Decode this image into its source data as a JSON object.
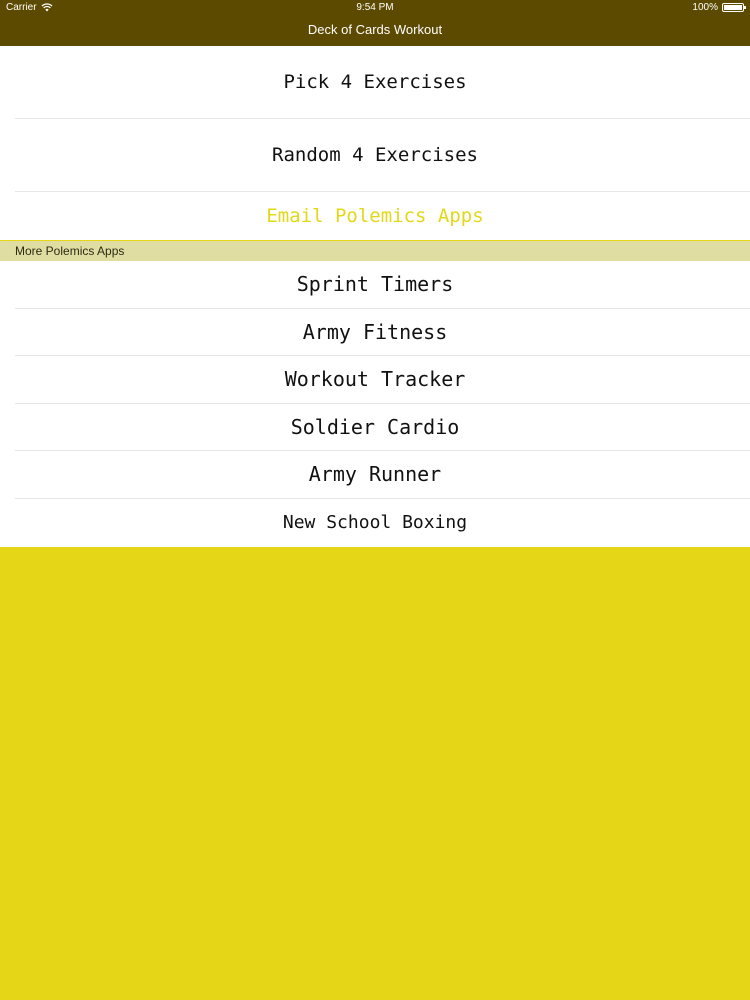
{
  "status_bar": {
    "carrier": "Carrier",
    "time": "9:54 PM",
    "battery": "100%",
    "battery_level": 1.0
  },
  "nav": {
    "title": "Deck of Cards Workout"
  },
  "menu": {
    "items": [
      {
        "label": "Pick 4 Exercises"
      },
      {
        "label": "Random 4 Exercises"
      },
      {
        "label": "Email Polemics Apps"
      }
    ]
  },
  "more_apps": {
    "header": "More Polemics Apps",
    "items": [
      {
        "label": "Sprint Timers"
      },
      {
        "label": "Army Fitness"
      },
      {
        "label": "Workout Tracker"
      },
      {
        "label": "Soldier Cardio"
      },
      {
        "label": "Army Runner"
      },
      {
        "label": "New School Boxing"
      }
    ]
  },
  "colors": {
    "nav_bar": "#5c4a00",
    "accent_yellow": "#e2d817",
    "background": "#e5d617",
    "section_header": "#e0dda3"
  }
}
